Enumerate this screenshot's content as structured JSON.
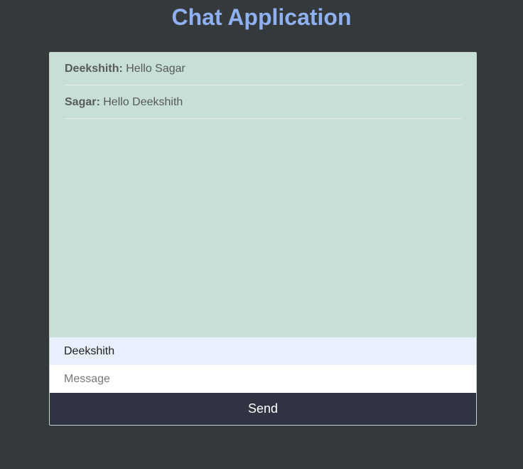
{
  "app": {
    "title": "Chat Application"
  },
  "messages": [
    {
      "sender": "Deekshith:",
      "text": "Hello Sagar"
    },
    {
      "sender": "Sagar:",
      "text": "Hello Deekshith"
    }
  ],
  "form": {
    "name_value": "Deekshith",
    "message_value": "",
    "message_placeholder": "Message",
    "send_label": "Send"
  },
  "colors": {
    "background": "#343a3c",
    "title": "#8fb0f1",
    "messages_bg": "#c8dfd6",
    "name_input_bg": "#e8f0fd",
    "send_button_bg": "#303342"
  }
}
